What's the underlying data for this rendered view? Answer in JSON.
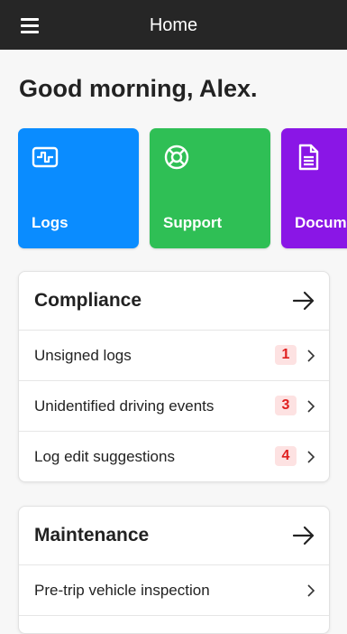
{
  "topbar": {
    "title": "Home",
    "menu_icon": "hamburger-menu-icon"
  },
  "greeting": "Good morning, Alex.",
  "tiles": [
    {
      "label": "Logs",
      "color": "#0a8cff",
      "icon": "logs-icon"
    },
    {
      "label": "Support",
      "color": "#2fbf55",
      "icon": "lifebuoy-icon"
    },
    {
      "label": "Documents",
      "color": "#8a16e6",
      "icon": "document-icon"
    }
  ],
  "compliance": {
    "title": "Compliance",
    "items": [
      {
        "label": "Unsigned logs",
        "count": "1"
      },
      {
        "label": "Unidentified driving events",
        "count": "3"
      },
      {
        "label": "Log edit suggestions",
        "count": "4"
      }
    ]
  },
  "maintenance": {
    "title": "Maintenance",
    "items": [
      {
        "label": "Pre-trip vehicle inspection"
      }
    ]
  },
  "colors": {
    "topbar": "#262626",
    "badge_bg": "#fde2e2",
    "badge_text": "#e02020"
  }
}
